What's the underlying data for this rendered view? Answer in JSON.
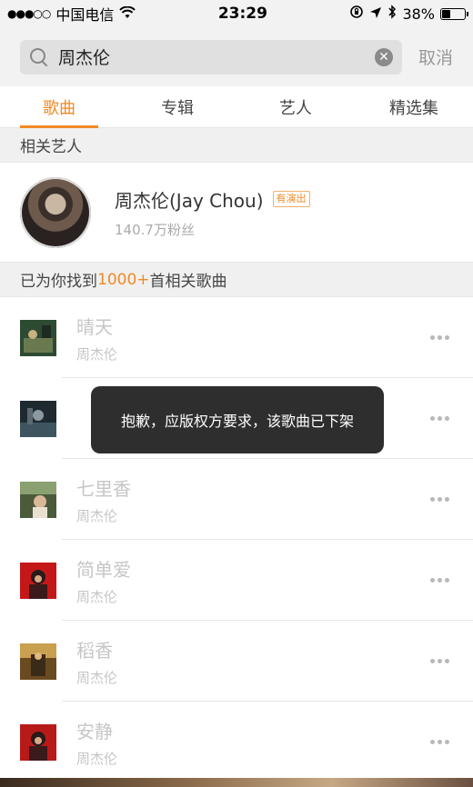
{
  "status_bar": {
    "carrier": "中国电信",
    "time": "23:29",
    "battery": "38%",
    "battery_level": 0.38
  },
  "search": {
    "query": "周杰伦",
    "cancel_label": "取消"
  },
  "tabs": [
    {
      "label": "歌曲",
      "active": true
    },
    {
      "label": "专辑",
      "active": false
    },
    {
      "label": "艺人",
      "active": false
    },
    {
      "label": "精选集",
      "active": false
    }
  ],
  "related_artists": {
    "header": "相关艺人",
    "artist": {
      "name": "周杰伦(Jay Chou)",
      "badge": "有演出",
      "fans": "140.7万粉丝"
    }
  },
  "songs_header": {
    "prefix": "已为你找到",
    "count": "1000+",
    "suffix": "首相关歌曲"
  },
  "songs": [
    {
      "title": "晴天",
      "artist": "周杰伦"
    },
    {
      "title": "",
      "artist": ""
    },
    {
      "title": "七里香",
      "artist": "周杰伦"
    },
    {
      "title": "简单爱",
      "artist": "周杰伦"
    },
    {
      "title": "稻香",
      "artist": "周杰伦"
    },
    {
      "title": "安静",
      "artist": "周杰伦"
    }
  ],
  "toast": {
    "message": "抱歉，应版权方要求，该歌曲已下架"
  },
  "colors": {
    "accent": "#f08a24"
  }
}
